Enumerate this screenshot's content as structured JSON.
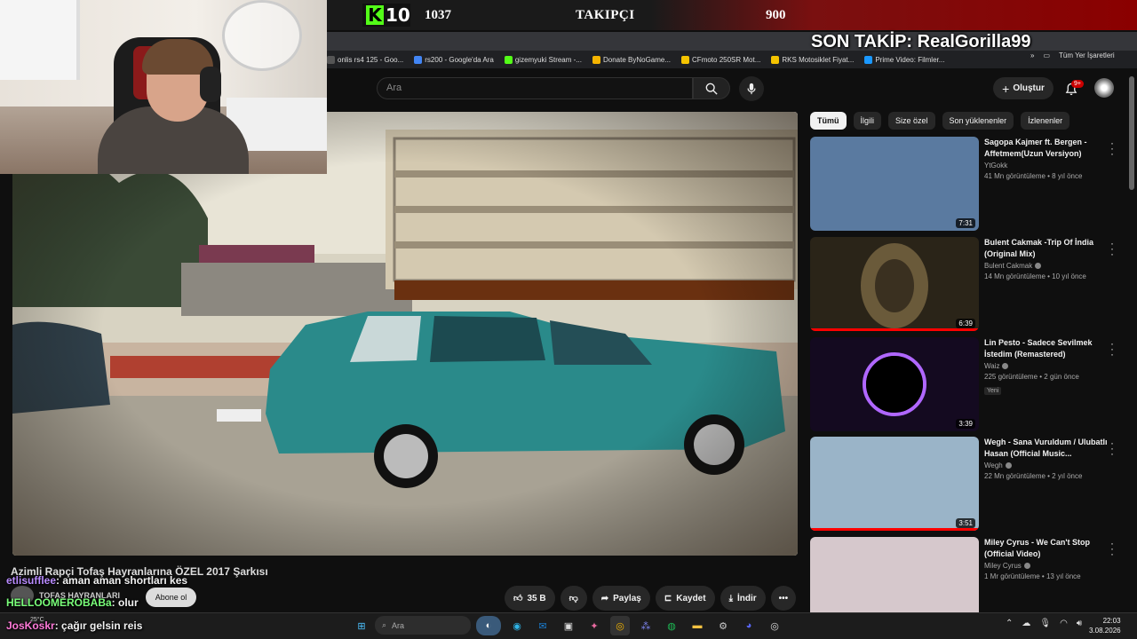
{
  "stream_overlay": {
    "kick_count": "10",
    "follower_count": "1037",
    "follower_label": "TAKIPÇI",
    "follower_goal": "900",
    "last_follow": "SON TAKİP: RealGorilla99"
  },
  "bookmarks": [
    {
      "label": "onlis rs4 125 - Goo...",
      "color": "#555"
    },
    {
      "label": "rs200 - Google'da Ara",
      "color": "#4285f4"
    },
    {
      "label": "gizemyuki Stream -...",
      "color": "#53fc18"
    },
    {
      "label": "Donate ByNoGame...",
      "color": "#f5b400"
    },
    {
      "label": "CFmoto 250SR Mot...",
      "color": "#f5c400"
    },
    {
      "label": "RKS Motosiklet Fiyat...",
      "color": "#f5c400"
    },
    {
      "label": "Prime Video: Filmler...",
      "color": "#1a98ff"
    }
  ],
  "bookmarks_right": {
    "all_bookmarks": "Tüm Yer İşaretleri"
  },
  "header": {
    "search_placeholder": "Ara",
    "create_label": "Oluştur",
    "notif_count": "9+"
  },
  "chips": [
    "Tümü",
    "İlgili",
    "Size özel",
    "Son yüklenenler",
    "İzlenenler"
  ],
  "recommendations": [
    {
      "title": "Sagopa Kajmer ft. Bergen - Affetmem(Uzun Versiyon)",
      "channel": "YtGokk",
      "verified": false,
      "meta": "41 Mn görüntüleme • 8 yıl önce",
      "duration": "7:31",
      "progress": 0,
      "new": "",
      "thumb": "#5a7aa0"
    },
    {
      "title": "Bulent Cakmak -Trip Of İndia (Original Mix)",
      "channel": "Bulent Cakmak",
      "verified": true,
      "meta": "14 Mn görüntüleme • 10 yıl önce",
      "duration": "6:39",
      "progress": 100,
      "new": "",
      "thumb": "#2a2418"
    },
    {
      "title": "Lin Pesto - Sadece Sevilmek İstedim (Remastered)",
      "channel": "Waiz",
      "verified": true,
      "meta": "225 görüntüleme • 2 gün önce",
      "duration": "3:39",
      "progress": 0,
      "new": "Yeni",
      "thumb": "#140a20"
    },
    {
      "title": "Wegh - Sana Vuruldum / Ulubatlı Hasan (Official Music...",
      "channel": "Wegh",
      "verified": true,
      "meta": "22 Mn görüntüleme • 2 yıl önce",
      "duration": "3:51",
      "progress": 100,
      "new": "",
      "thumb": "#9ab4c8"
    },
    {
      "title": "Miley Cyrus - We Can't Stop (Official Video)",
      "channel": "Miley Cyrus",
      "verified": true,
      "meta": "1 Mr görüntüleme • 13 yıl önce",
      "duration": "",
      "progress": 0,
      "new": "",
      "thumb": "#d6c8cc"
    }
  ],
  "video": {
    "title": "Azimli Rapçi Tofaş Hayranlarına ÖZEL 2017 Şarkısı",
    "channel": "TOFAŞ HAYRANLARI",
    "subscribe": "Abone ol",
    "likes": "35 B",
    "share": "Paylaş",
    "save": "Kaydet",
    "download": "İndir"
  },
  "chat": [
    {
      "user": "etlisufflee",
      "text": ": aman aman shortları kes"
    },
    {
      "user": "HELLOOMEROBABa",
      "text": ": olur"
    },
    {
      "user": "JosKoskr",
      "text": ": çağır gelsin reis"
    }
  ],
  "taskbar": {
    "weather_temp": "25°C",
    "search_label": "Ara",
    "time": "22:03",
    "date": "3.08.2026"
  }
}
